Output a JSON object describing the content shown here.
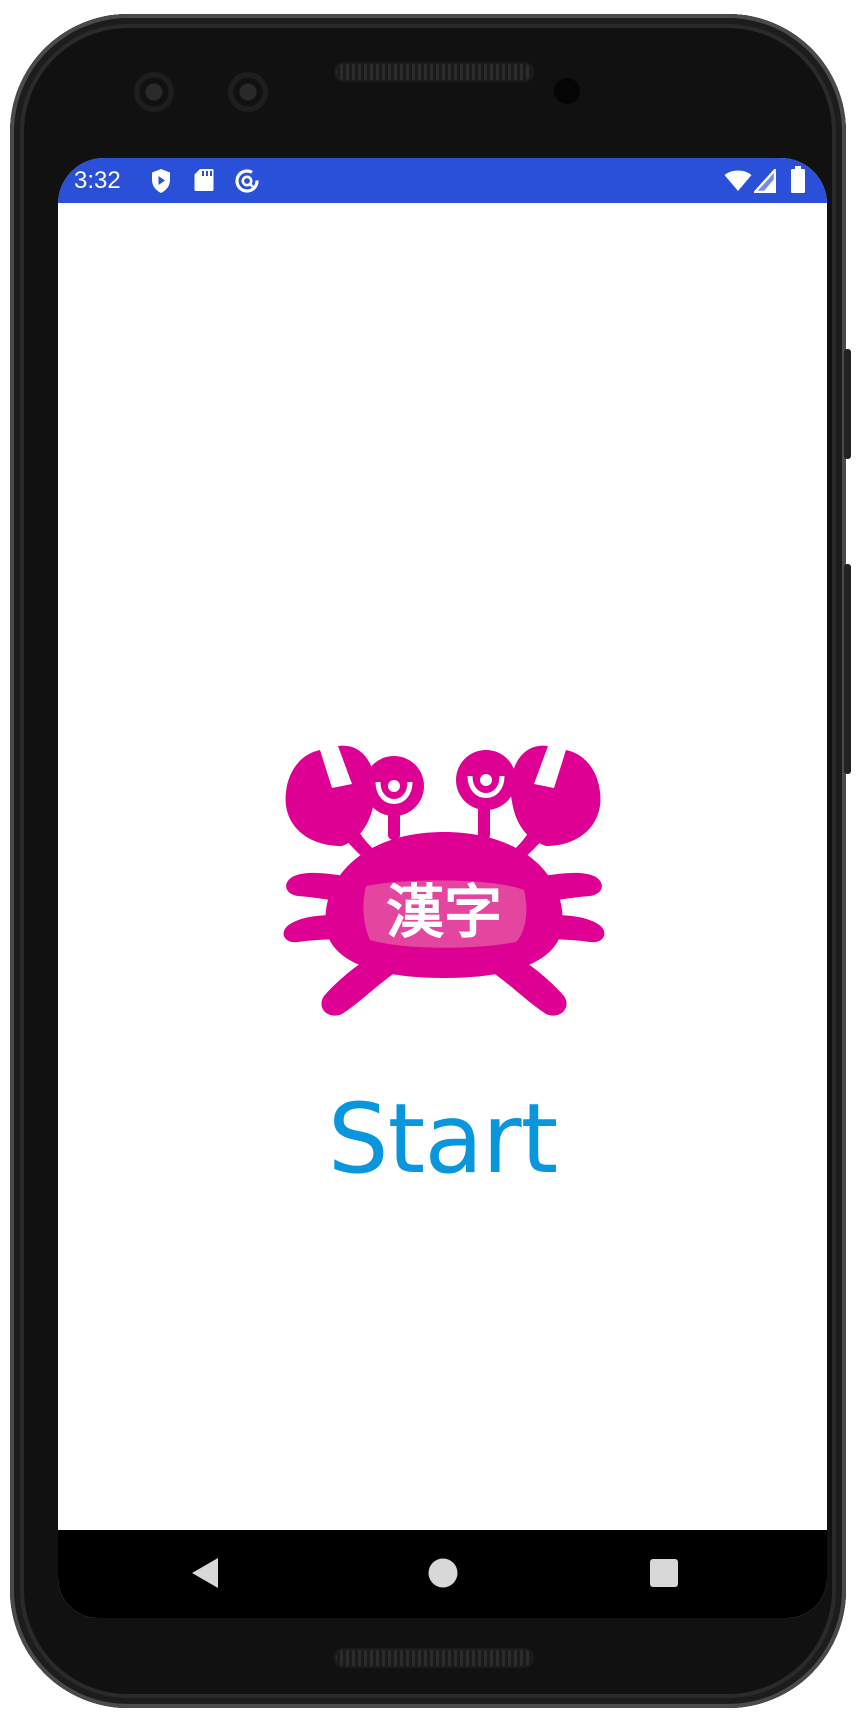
{
  "status_bar": {
    "time": "3:32",
    "left_icons": [
      "play-protect-icon",
      "sd-card-icon",
      "data-saver-icon"
    ],
    "right_icons": [
      "wifi-icon",
      "cell-signal-icon",
      "battery-icon"
    ],
    "color": "#2a4fd9"
  },
  "splash": {
    "logo_text": "漢字",
    "logo_color": "#de0093",
    "start_label": "Start",
    "start_color": "#0a96dd"
  },
  "nav_bar": {
    "buttons": [
      "back-icon",
      "home-icon",
      "recents-icon"
    ]
  }
}
